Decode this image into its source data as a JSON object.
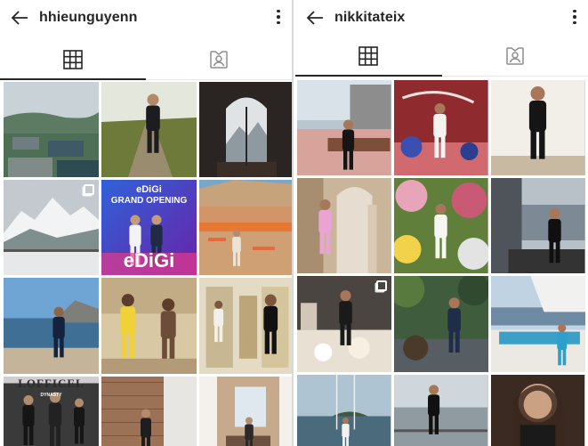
{
  "left_profile": {
    "username": "hhieunguyenn",
    "icons": {
      "back": "back-arrow-icon",
      "more": "more-vertical-icon",
      "grid": "grid-icon",
      "tagged": "tagged-icon"
    },
    "tiles": [
      {
        "kind": "city",
        "multi": false
      },
      {
        "kind": "rail",
        "multi": false
      },
      {
        "kind": "window",
        "multi": false
      },
      {
        "kind": "snow",
        "multi": true
      },
      {
        "kind": "edigi",
        "multi": false,
        "line1": "eDiGi",
        "line2": "GRAND OPENING",
        "line3": "eDiGi"
      },
      {
        "kind": "beach",
        "multi": false
      },
      {
        "kind": "seaside",
        "multi": false
      },
      {
        "kind": "yellow",
        "multi": false
      },
      {
        "kind": "palace",
        "multi": false
      },
      {
        "kind": "magazine",
        "multi": false,
        "line1": "LOFFICEL",
        "line2": "DYNASTY"
      },
      {
        "kind": "brick",
        "multi": false
      },
      {
        "kind": "room",
        "multi": false
      }
    ]
  },
  "right_profile": {
    "username": "nikkitateix",
    "icons": {
      "back": "back-arrow-icon",
      "more": "more-vertical-icon",
      "grid": "grid-icon",
      "tagged": "tagged-icon"
    },
    "tiles": [
      {
        "kind": "street",
        "multi": false
      },
      {
        "kind": "redwall",
        "multi": false
      },
      {
        "kind": "blackdress",
        "multi": false
      },
      {
        "kind": "pinkdress",
        "multi": false
      },
      {
        "kind": "garden",
        "multi": false
      },
      {
        "kind": "rainwindow",
        "multi": false
      },
      {
        "kind": "tea",
        "multi": true
      },
      {
        "kind": "jungle",
        "multi": false
      },
      {
        "kind": "yacht",
        "multi": false
      },
      {
        "kind": "swing",
        "multi": false
      },
      {
        "kind": "terrace",
        "multi": false
      },
      {
        "kind": "portrait",
        "multi": false
      }
    ]
  }
}
